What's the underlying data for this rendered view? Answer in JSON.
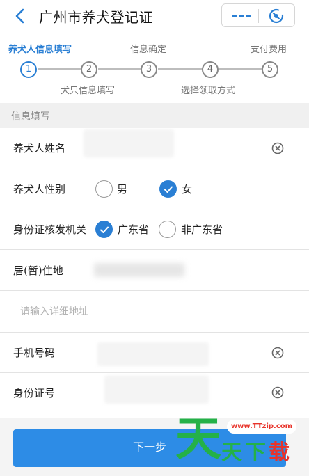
{
  "header": {
    "title": "广州市养犬登记证",
    "more_icon": "more-dots-icon",
    "close_icon": "close-target-icon"
  },
  "steps": {
    "top_labels": [
      "养犬人信息填写",
      "信息确定",
      "支付费用"
    ],
    "bottom_labels": [
      "犬只信息填写",
      "选择领取方式"
    ],
    "numbers": [
      "1",
      "2",
      "3",
      "4",
      "5"
    ],
    "active_index": 1,
    "active_color": "#2a7fd4"
  },
  "form": {
    "section_title": "信息填写",
    "owner_name_label": "养犬人姓名",
    "gender_label": "养犬人性别",
    "gender_options": [
      "男",
      "女"
    ],
    "gender_selected": "女",
    "id_authority_label": "身份证核发机关",
    "authority_options": [
      "广东省",
      "非广东省"
    ],
    "authority_selected": "广东省",
    "residence_label": "居(暂)住地",
    "address_placeholder": "请输入详细地址",
    "phone_label": "手机号码",
    "id_number_label": "身份证号"
  },
  "actions": {
    "next_label": "下一步"
  },
  "watermark": {
    "url": "www.TTzip.com",
    "big": "天",
    "chars": [
      "天",
      "下",
      "载"
    ]
  },
  "colors": {
    "accent": "#2a7fd4",
    "button": "#2d8ce6"
  }
}
